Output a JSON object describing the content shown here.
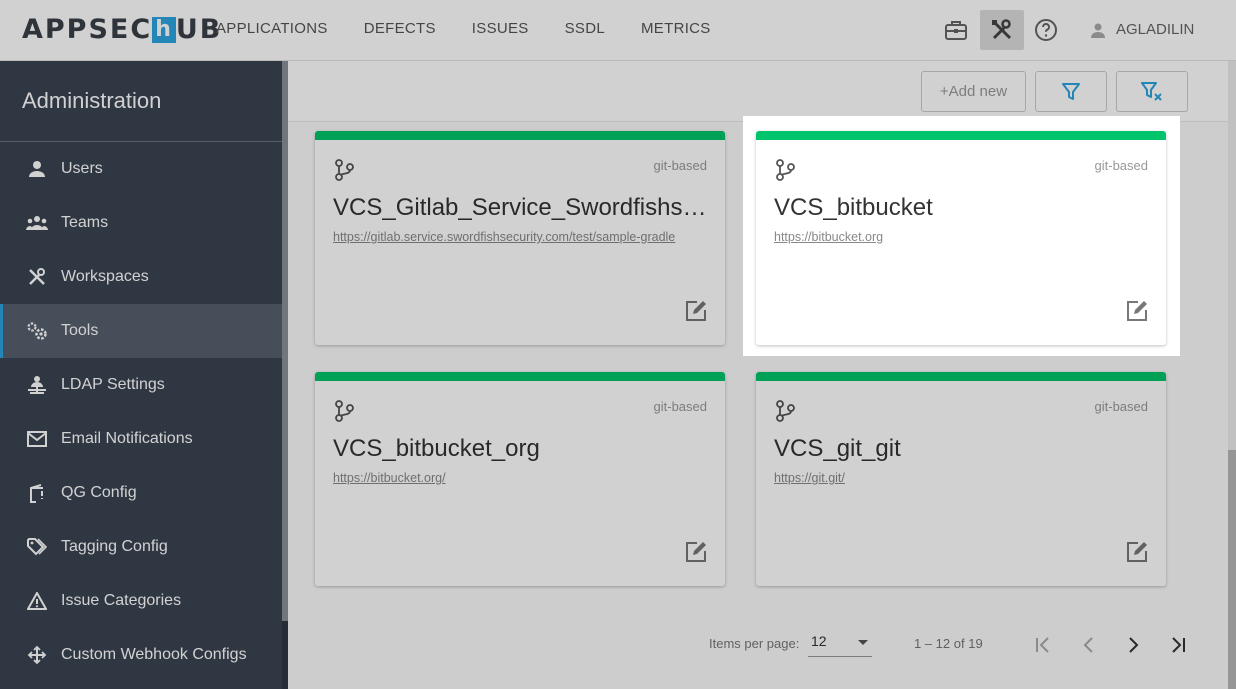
{
  "header": {
    "logo_left": "APPSEC",
    "logo_h": "h",
    "logo_right": "UB",
    "nav": [
      "APPLICATIONS",
      "DEFECTS",
      "ISSUES",
      "SSDL",
      "METRICS"
    ],
    "icons": [
      "briefcase-icon",
      "tools-icon",
      "help-icon"
    ],
    "user": "AGLADILIN"
  },
  "sidebar": {
    "title": "Administration",
    "items": [
      {
        "label": "Users",
        "icon": "person-icon"
      },
      {
        "label": "Teams",
        "icon": "group-icon"
      },
      {
        "label": "Workspaces",
        "icon": "workspaces-icon"
      },
      {
        "label": "Tools",
        "icon": "gears-icon",
        "active": true
      },
      {
        "label": "LDAP Settings",
        "icon": "ldap-icon"
      },
      {
        "label": "Email Notifications",
        "icon": "mail-icon"
      },
      {
        "label": "QG Config",
        "icon": "crane-icon"
      },
      {
        "label": "Tagging Config",
        "icon": "tag-icon"
      },
      {
        "label": "Issue Categories",
        "icon": "warning-icon"
      },
      {
        "label": "Custom Webhook Configs",
        "icon": "webhook-icon"
      }
    ]
  },
  "toolbar": {
    "add_label": "+Add new"
  },
  "cards": [
    {
      "type": "git-based",
      "name": "VCS_Gitlab_Service_Swordfishsecurity",
      "url": "https://gitlab.service.swordfishsecurity.com/test/sample-gradle"
    },
    {
      "type": "git-based",
      "name": "VCS_bitbucket",
      "url": "https://bitbucket.org"
    },
    {
      "type": "git-based",
      "name": "VCS_bitbucket_org",
      "url": "https://bitbucket.org/"
    },
    {
      "type": "git-based",
      "name": "VCS_git_git",
      "url": "https://git.git/"
    }
  ],
  "paginator": {
    "items_per_page_label": "Items per page:",
    "items_per_page": "12",
    "range": "1 – 12 of 19"
  },
  "colors": {
    "accent": "#2da3e0",
    "card_bar": "#00c46b",
    "sidebar_bg": "#3a4452"
  }
}
